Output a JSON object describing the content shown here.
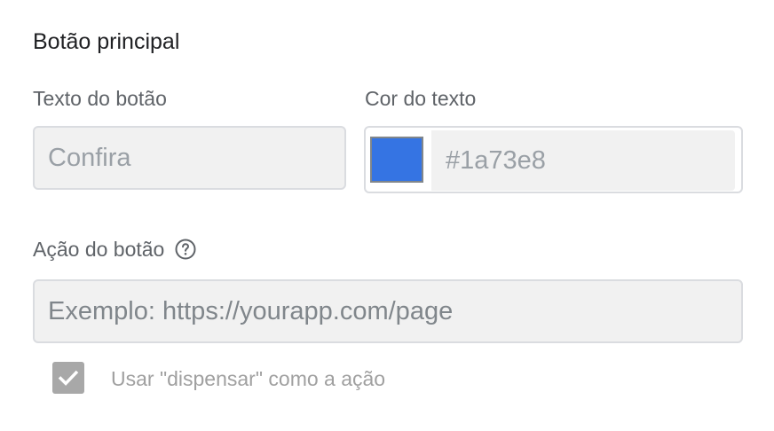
{
  "section": {
    "title": "Botão principal"
  },
  "button_text_field": {
    "label": "Texto do botão",
    "placeholder": "Confira"
  },
  "text_color_field": {
    "label": "Cor do texto",
    "value": "#1a73e8",
    "swatch_color": "#3574e3"
  },
  "button_action_field": {
    "label": "Ação do botão",
    "help_icon": "help-circle-icon",
    "placeholder": "Exemplo: https://yourapp.com/page"
  },
  "dismiss_option": {
    "label": "Usar \"dispensar\" como a ação",
    "checked": true,
    "check_icon": "checkmark-icon"
  }
}
